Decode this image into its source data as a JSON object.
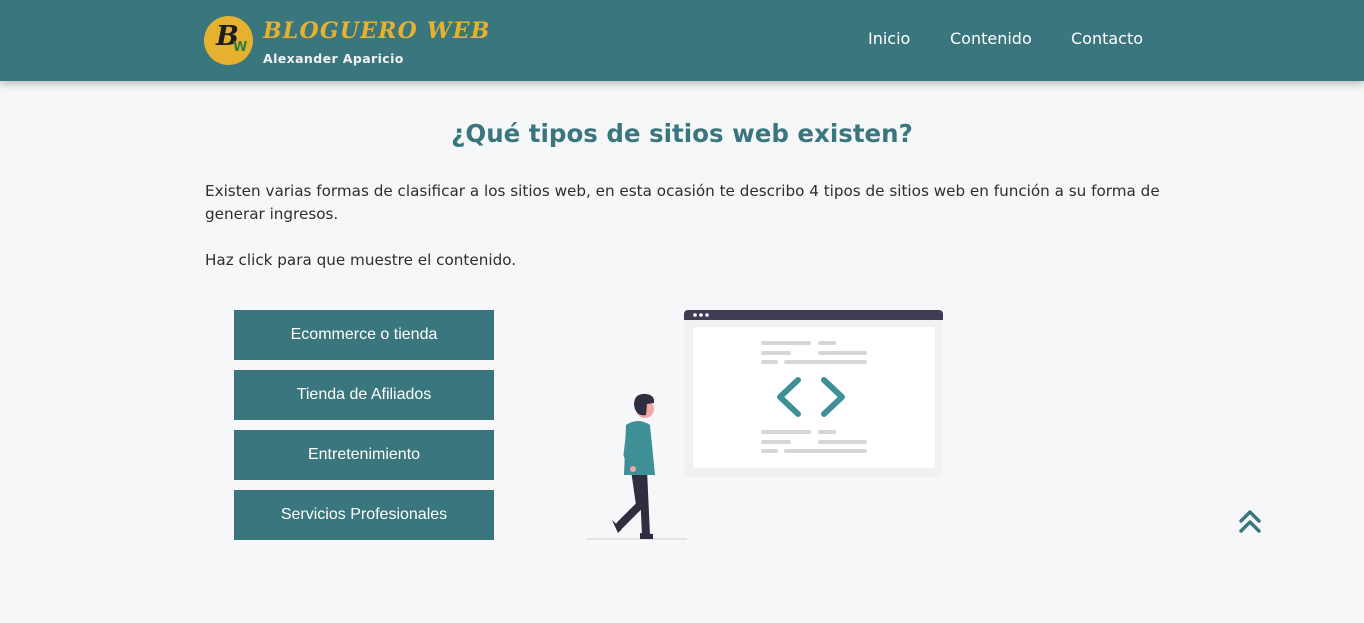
{
  "header": {
    "logo_mark": "B",
    "logo_sub_mark": "W",
    "brand_title": "BLOGUERO WEB",
    "brand_subtitle": "Alexander Aparicio",
    "nav": [
      {
        "label": "Inicio"
      },
      {
        "label": "Contenido"
      },
      {
        "label": "Contacto"
      }
    ]
  },
  "main": {
    "title": "¿Qué tipos de sitios web existen?",
    "intro": "Existen varias formas de clasificar a los sitios web, en esta ocasión te describo 4 tipos de sitios web en función a su forma de generar ingresos.",
    "hint": "Haz click para que muestre el contenido.",
    "buttons": [
      {
        "label": "Ecommerce o tienda"
      },
      {
        "label": "Tienda de Afiliados"
      },
      {
        "label": "Entretenimiento"
      },
      {
        "label": "Servicios Profesionales"
      }
    ]
  },
  "illustration": {
    "name": "person-walking-to-code-window"
  },
  "controls": {
    "scroll_top_icon": "double-chevron-up-icon"
  },
  "colors": {
    "primary": "#3a767d",
    "accent": "#e5b12f",
    "background": "#f6f7f9",
    "text": "#2e2e2e"
  }
}
